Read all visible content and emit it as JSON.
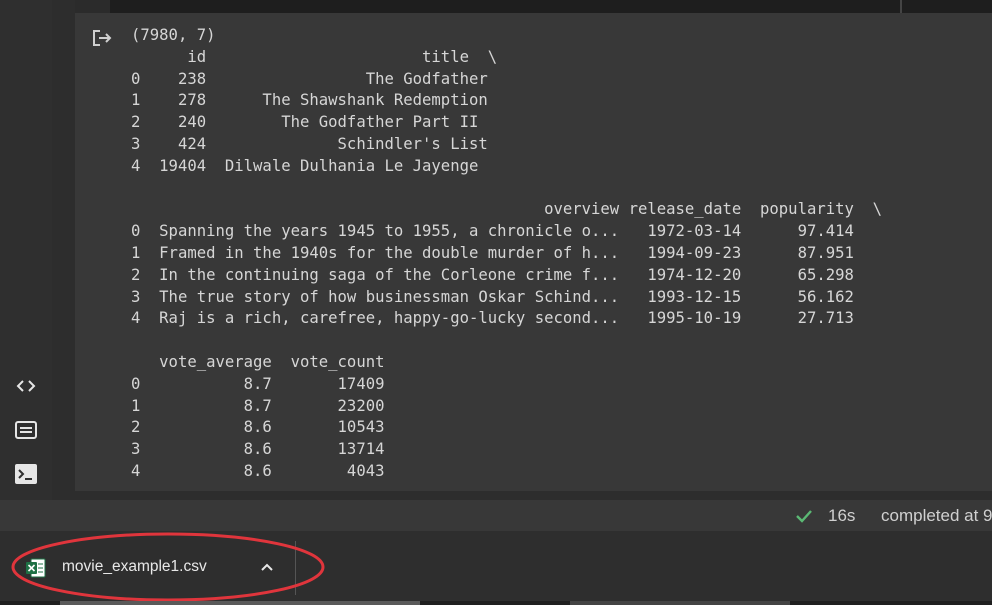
{
  "output": {
    "lines": [
      "(7980, 7)",
      "      id                       title  \\",
      "0    238                 The Godfather  ",
      "1    278      The Shawshank Redemption  ",
      "2    240        The Godfather Part II  ",
      "3    424              Schindler's List  ",
      "4  19404  Dilwale Dulhania Le Jayenge  ",
      "",
      "                                            overview release_date  popularity  \\",
      "0  Spanning the years 1945 to 1955, a chronicle o...   1972-03-14      97.414   ",
      "1  Framed in the 1940s for the double murder of h...   1994-09-23      87.951   ",
      "2  In the continuing saga of the Corleone crime f...   1974-12-20      65.298   ",
      "3  The true story of how businessman Oskar Schind...   1993-12-15      56.162   ",
      "4  Raj is a rich, carefree, happy-go-lucky second...   1995-10-19      27.713   ",
      "",
      "   vote_average  vote_count  ",
      "0           8.7       17409  ",
      "1           8.7       23200  ",
      "2           8.6       10543  ",
      "3           8.6       13714  ",
      "4           8.6        4043  "
    ]
  },
  "status": {
    "duration": "16s",
    "completed": "completed at 9"
  },
  "download": {
    "file_name": "movie_example1.csv"
  },
  "icons": {
    "output": "output-arrow-icon",
    "code": "code-brackets-icon",
    "snippets": "snippets-icon",
    "terminal": "terminal-icon",
    "check": "check-icon",
    "file": "excel-file-icon",
    "chevron": "chevron-up-icon"
  },
  "colors": {
    "check": "#5bb974",
    "highlight": "#e0353c",
    "excel": "#1e7145"
  }
}
